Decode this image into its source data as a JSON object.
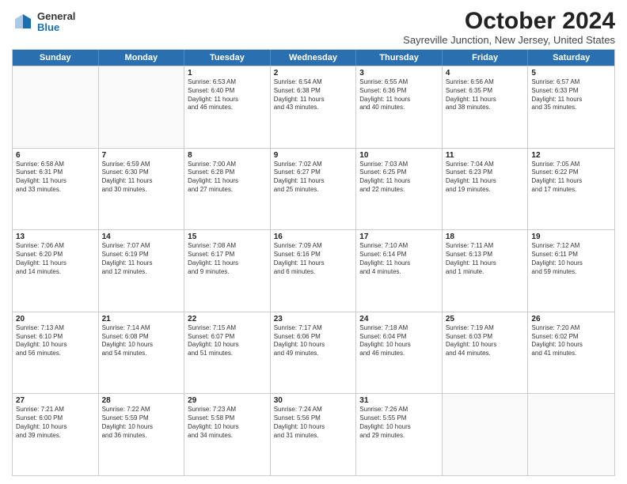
{
  "logo": {
    "general": "General",
    "blue": "Blue"
  },
  "title": "October 2024",
  "location": "Sayreville Junction, New Jersey, United States",
  "days": [
    "Sunday",
    "Monday",
    "Tuesday",
    "Wednesday",
    "Thursday",
    "Friday",
    "Saturday"
  ],
  "weeks": [
    [
      {
        "day": "",
        "lines": []
      },
      {
        "day": "",
        "lines": []
      },
      {
        "day": "1",
        "lines": [
          "Sunrise: 6:53 AM",
          "Sunset: 6:40 PM",
          "Daylight: 11 hours",
          "and 46 minutes."
        ]
      },
      {
        "day": "2",
        "lines": [
          "Sunrise: 6:54 AM",
          "Sunset: 6:38 PM",
          "Daylight: 11 hours",
          "and 43 minutes."
        ]
      },
      {
        "day": "3",
        "lines": [
          "Sunrise: 6:55 AM",
          "Sunset: 6:36 PM",
          "Daylight: 11 hours",
          "and 40 minutes."
        ]
      },
      {
        "day": "4",
        "lines": [
          "Sunrise: 6:56 AM",
          "Sunset: 6:35 PM",
          "Daylight: 11 hours",
          "and 38 minutes."
        ]
      },
      {
        "day": "5",
        "lines": [
          "Sunrise: 6:57 AM",
          "Sunset: 6:33 PM",
          "Daylight: 11 hours",
          "and 35 minutes."
        ]
      }
    ],
    [
      {
        "day": "6",
        "lines": [
          "Sunrise: 6:58 AM",
          "Sunset: 6:31 PM",
          "Daylight: 11 hours",
          "and 33 minutes."
        ]
      },
      {
        "day": "7",
        "lines": [
          "Sunrise: 6:59 AM",
          "Sunset: 6:30 PM",
          "Daylight: 11 hours",
          "and 30 minutes."
        ]
      },
      {
        "day": "8",
        "lines": [
          "Sunrise: 7:00 AM",
          "Sunset: 6:28 PM",
          "Daylight: 11 hours",
          "and 27 minutes."
        ]
      },
      {
        "day": "9",
        "lines": [
          "Sunrise: 7:02 AM",
          "Sunset: 6:27 PM",
          "Daylight: 11 hours",
          "and 25 minutes."
        ]
      },
      {
        "day": "10",
        "lines": [
          "Sunrise: 7:03 AM",
          "Sunset: 6:25 PM",
          "Daylight: 11 hours",
          "and 22 minutes."
        ]
      },
      {
        "day": "11",
        "lines": [
          "Sunrise: 7:04 AM",
          "Sunset: 6:23 PM",
          "Daylight: 11 hours",
          "and 19 minutes."
        ]
      },
      {
        "day": "12",
        "lines": [
          "Sunrise: 7:05 AM",
          "Sunset: 6:22 PM",
          "Daylight: 11 hours",
          "and 17 minutes."
        ]
      }
    ],
    [
      {
        "day": "13",
        "lines": [
          "Sunrise: 7:06 AM",
          "Sunset: 6:20 PM",
          "Daylight: 11 hours",
          "and 14 minutes."
        ]
      },
      {
        "day": "14",
        "lines": [
          "Sunrise: 7:07 AM",
          "Sunset: 6:19 PM",
          "Daylight: 11 hours",
          "and 12 minutes."
        ]
      },
      {
        "day": "15",
        "lines": [
          "Sunrise: 7:08 AM",
          "Sunset: 6:17 PM",
          "Daylight: 11 hours",
          "and 9 minutes."
        ]
      },
      {
        "day": "16",
        "lines": [
          "Sunrise: 7:09 AM",
          "Sunset: 6:16 PM",
          "Daylight: 11 hours",
          "and 6 minutes."
        ]
      },
      {
        "day": "17",
        "lines": [
          "Sunrise: 7:10 AM",
          "Sunset: 6:14 PM",
          "Daylight: 11 hours",
          "and 4 minutes."
        ]
      },
      {
        "day": "18",
        "lines": [
          "Sunrise: 7:11 AM",
          "Sunset: 6:13 PM",
          "Daylight: 11 hours",
          "and 1 minute."
        ]
      },
      {
        "day": "19",
        "lines": [
          "Sunrise: 7:12 AM",
          "Sunset: 6:11 PM",
          "Daylight: 10 hours",
          "and 59 minutes."
        ]
      }
    ],
    [
      {
        "day": "20",
        "lines": [
          "Sunrise: 7:13 AM",
          "Sunset: 6:10 PM",
          "Daylight: 10 hours",
          "and 56 minutes."
        ]
      },
      {
        "day": "21",
        "lines": [
          "Sunrise: 7:14 AM",
          "Sunset: 6:08 PM",
          "Daylight: 10 hours",
          "and 54 minutes."
        ]
      },
      {
        "day": "22",
        "lines": [
          "Sunrise: 7:15 AM",
          "Sunset: 6:07 PM",
          "Daylight: 10 hours",
          "and 51 minutes."
        ]
      },
      {
        "day": "23",
        "lines": [
          "Sunrise: 7:17 AM",
          "Sunset: 6:06 PM",
          "Daylight: 10 hours",
          "and 49 minutes."
        ]
      },
      {
        "day": "24",
        "lines": [
          "Sunrise: 7:18 AM",
          "Sunset: 6:04 PM",
          "Daylight: 10 hours",
          "and 46 minutes."
        ]
      },
      {
        "day": "25",
        "lines": [
          "Sunrise: 7:19 AM",
          "Sunset: 6:03 PM",
          "Daylight: 10 hours",
          "and 44 minutes."
        ]
      },
      {
        "day": "26",
        "lines": [
          "Sunrise: 7:20 AM",
          "Sunset: 6:02 PM",
          "Daylight: 10 hours",
          "and 41 minutes."
        ]
      }
    ],
    [
      {
        "day": "27",
        "lines": [
          "Sunrise: 7:21 AM",
          "Sunset: 6:00 PM",
          "Daylight: 10 hours",
          "and 39 minutes."
        ]
      },
      {
        "day": "28",
        "lines": [
          "Sunrise: 7:22 AM",
          "Sunset: 5:59 PM",
          "Daylight: 10 hours",
          "and 36 minutes."
        ]
      },
      {
        "day": "29",
        "lines": [
          "Sunrise: 7:23 AM",
          "Sunset: 5:58 PM",
          "Daylight: 10 hours",
          "and 34 minutes."
        ]
      },
      {
        "day": "30",
        "lines": [
          "Sunrise: 7:24 AM",
          "Sunset: 5:56 PM",
          "Daylight: 10 hours",
          "and 31 minutes."
        ]
      },
      {
        "day": "31",
        "lines": [
          "Sunrise: 7:26 AM",
          "Sunset: 5:55 PM",
          "Daylight: 10 hours",
          "and 29 minutes."
        ]
      },
      {
        "day": "",
        "lines": []
      },
      {
        "day": "",
        "lines": []
      }
    ]
  ]
}
